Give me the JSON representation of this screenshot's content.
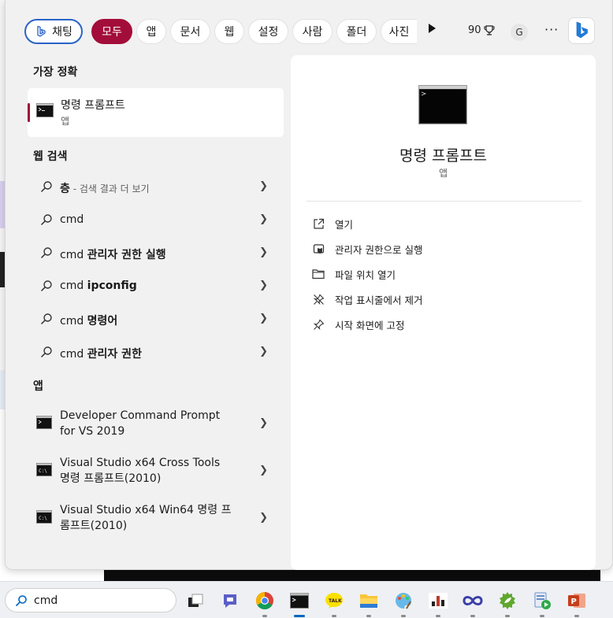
{
  "filters": {
    "chat_label": "채팅",
    "chips": [
      {
        "label": "모두",
        "active": true
      },
      {
        "label": "앱",
        "active": false
      },
      {
        "label": "문서",
        "active": false
      },
      {
        "label": "웹",
        "active": false
      },
      {
        "label": "설정",
        "active": false
      },
      {
        "label": "사람",
        "active": false
      },
      {
        "label": "폴더",
        "active": false
      },
      {
        "label": "사진",
        "active": false
      }
    ],
    "points": "90",
    "avatar_letter": "G",
    "more_label": "···",
    "accent_color": "#a30d39"
  },
  "best_match": {
    "section_title": "가장 정확",
    "name": "명령 프롬프트",
    "type": "앱"
  },
  "web_search": {
    "section_title": "웹 검색",
    "rows": [
      {
        "prefix": "",
        "bold": "층",
        "muted": " - 검색 결과 더 보기"
      },
      {
        "prefix": "cmd",
        "bold": "",
        "muted": ""
      },
      {
        "prefix": "cmd ",
        "bold": "관리자 권한 실행",
        "muted": ""
      },
      {
        "prefix": "cmd ",
        "bold": "ipconfig",
        "muted": ""
      },
      {
        "prefix": "cmd ",
        "bold": "명령어",
        "muted": ""
      },
      {
        "prefix": "cmd ",
        "bold": "관리자 권한",
        "muted": ""
      }
    ]
  },
  "apps": {
    "section_title": "앱",
    "rows": [
      {
        "name": "Developer Command Prompt for VS 2019"
      },
      {
        "name": "Visual Studio x64 Cross Tools 명령 프롬프트(2010)"
      },
      {
        "name": "Visual Studio x64 Win64 명령 프롬프트(2010)"
      }
    ]
  },
  "details": {
    "title": "명령 프롬프트",
    "type": "앱",
    "actions": [
      {
        "label": "열기",
        "icon": "open-external-icon"
      },
      {
        "label": "관리자 권한으로 실행",
        "icon": "shield-icon"
      },
      {
        "label": "파일 위치 열기",
        "icon": "folder-icon"
      },
      {
        "label": "작업 표시줄에서 제거",
        "icon": "unpin-icon"
      },
      {
        "label": "시작 화면에 고정",
        "icon": "pin-icon"
      }
    ]
  },
  "taskbar": {
    "search_value": "cmd",
    "apps": [
      "task-view-icon",
      "teams-chat-icon",
      "chrome-icon",
      "terminal-icon",
      "kakaotalk-icon",
      "file-explorer-icon",
      "paint-icon",
      "bar-app-icon",
      "visual-studio-icon",
      "spring-tool-icon",
      "media-app-icon",
      "powerpoint-icon"
    ]
  }
}
